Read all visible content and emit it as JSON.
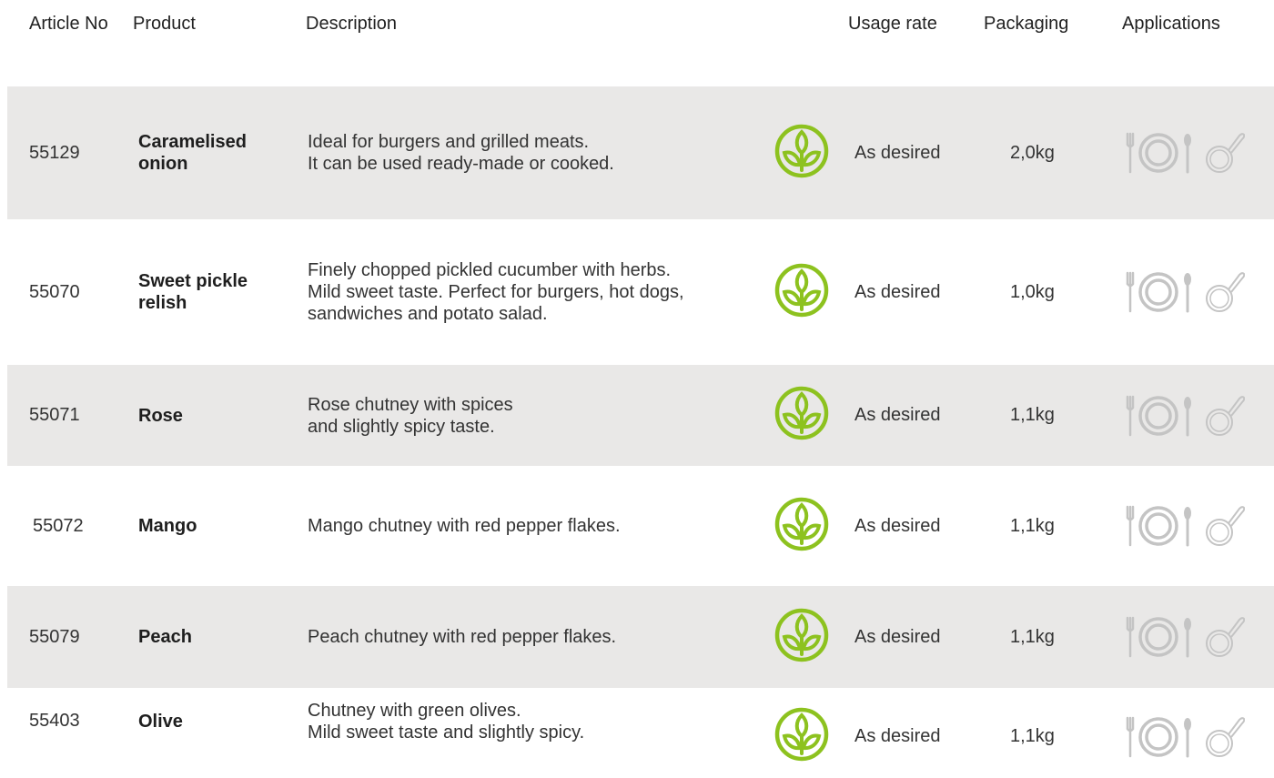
{
  "header": {
    "article_no": "Article No",
    "product": "Product",
    "description": "Description",
    "usage_rate": "Usage rate",
    "packaging": "Packaging",
    "applications": "Applications"
  },
  "colors": {
    "row_shade": "#e9e8e7",
    "leaf_green": "#8dc21f",
    "icon_grey": "#c4c4c4"
  },
  "icons": {
    "product_badge": "leaf-sprout-icon",
    "applications": [
      "plate-cutlery-icon",
      "frying-pan-icon"
    ]
  },
  "rows": [
    {
      "article_no": "55129",
      "product": "Caramelised onion",
      "description": "Ideal for burgers and grilled meats.\nIt can be used ready-made or cooked.",
      "usage_rate": "As desired",
      "packaging": "2,0kg"
    },
    {
      "article_no": "55070",
      "product": "Sweet pickle relish",
      "description": "Finely chopped pickled cucumber with herbs.\nMild sweet taste. Perfect for burgers, hot dogs,\nsandwiches and potato salad.",
      "usage_rate": "As desired",
      "packaging": "1,0kg"
    },
    {
      "article_no": "55071",
      "product": "Rose",
      "description": "Rose chutney with spices\nand slightly spicy taste.",
      "usage_rate": "As desired",
      "packaging": "1,1kg"
    },
    {
      "article_no": "55072",
      "product": "Mango",
      "description": "Mango chutney with red pepper flakes.",
      "usage_rate": "As desired",
      "packaging": "1,1kg"
    },
    {
      "article_no": "55079",
      "product": "Peach",
      "description": "Peach chutney with red pepper flakes.",
      "usage_rate": "As desired",
      "packaging": "1,1kg"
    },
    {
      "article_no": "55403",
      "product": "Olive",
      "description": "Chutney with green olives.\nMild sweet taste and slightly spicy.",
      "usage_rate": "As desired",
      "packaging": "1,1kg"
    }
  ]
}
